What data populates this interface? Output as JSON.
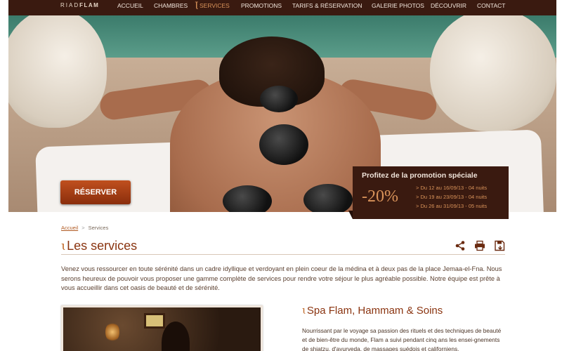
{
  "brand": {
    "logo_light": "RIAD",
    "logo_bold": "FLAM"
  },
  "nav": {
    "items": [
      {
        "label": "ACCUEIL",
        "active": false
      },
      {
        "label": "CHAMBRES",
        "active": false
      },
      {
        "label": "SERVICES",
        "active": true
      },
      {
        "label": "PROMOTIONS",
        "active": false
      },
      {
        "label": "TARIFS & RÉSERVATION",
        "active": false
      },
      {
        "label": "GALERIE PHOTOS",
        "active": false
      },
      {
        "label": "DÉCOUVRIR",
        "active": false
      },
      {
        "label": "CONTACT",
        "active": false
      }
    ]
  },
  "hero": {
    "reserve_label": "RÉSERVER",
    "promo": {
      "title": "Profitez de la promotion spéciale",
      "discount": "-20%",
      "lines": [
        "> Du 12 au 16/09/13 - 04 nuits",
        "> Du 19 au 23/09/13 - 04 nuits",
        "> Du 26 au 31/09/13 - 05 nuits"
      ]
    }
  },
  "breadcrumb": {
    "home": "Accueil",
    "separator": ">",
    "current": "Services"
  },
  "page": {
    "title": "Les services",
    "intro": "Venez vous ressourcer en toute sérénité dans un cadre idyllique et verdoyant en plein coeur de la médina et à deux pas de la place Jemaa-el-Fna. Nous serons heureux de pouvoir vous proposer une gamme complète de services pour rendre votre séjour le plus agréable possible. Notre équipe est prête à vous accueillir dans cet oasis de beauté et de sérénité."
  },
  "tools": {
    "share_icon": "share-icon",
    "print_icon": "print-icon",
    "save_icon": "save-icon"
  },
  "section": {
    "title": "Spa Flam, Hammam & Soins",
    "text": "Nourrissant par le voyage sa passion des rituels et des techniques de beauté et de bien-être du monde, Flam a suivi pendant cinq ans les ensei-gnements de shiatzu, d'ayurveda, de massages suédois et californiens."
  },
  "colors": {
    "nav_bg": "#3a1a10",
    "accent": "#d9935a",
    "title": "#8a3410",
    "button": "#b0461a"
  }
}
